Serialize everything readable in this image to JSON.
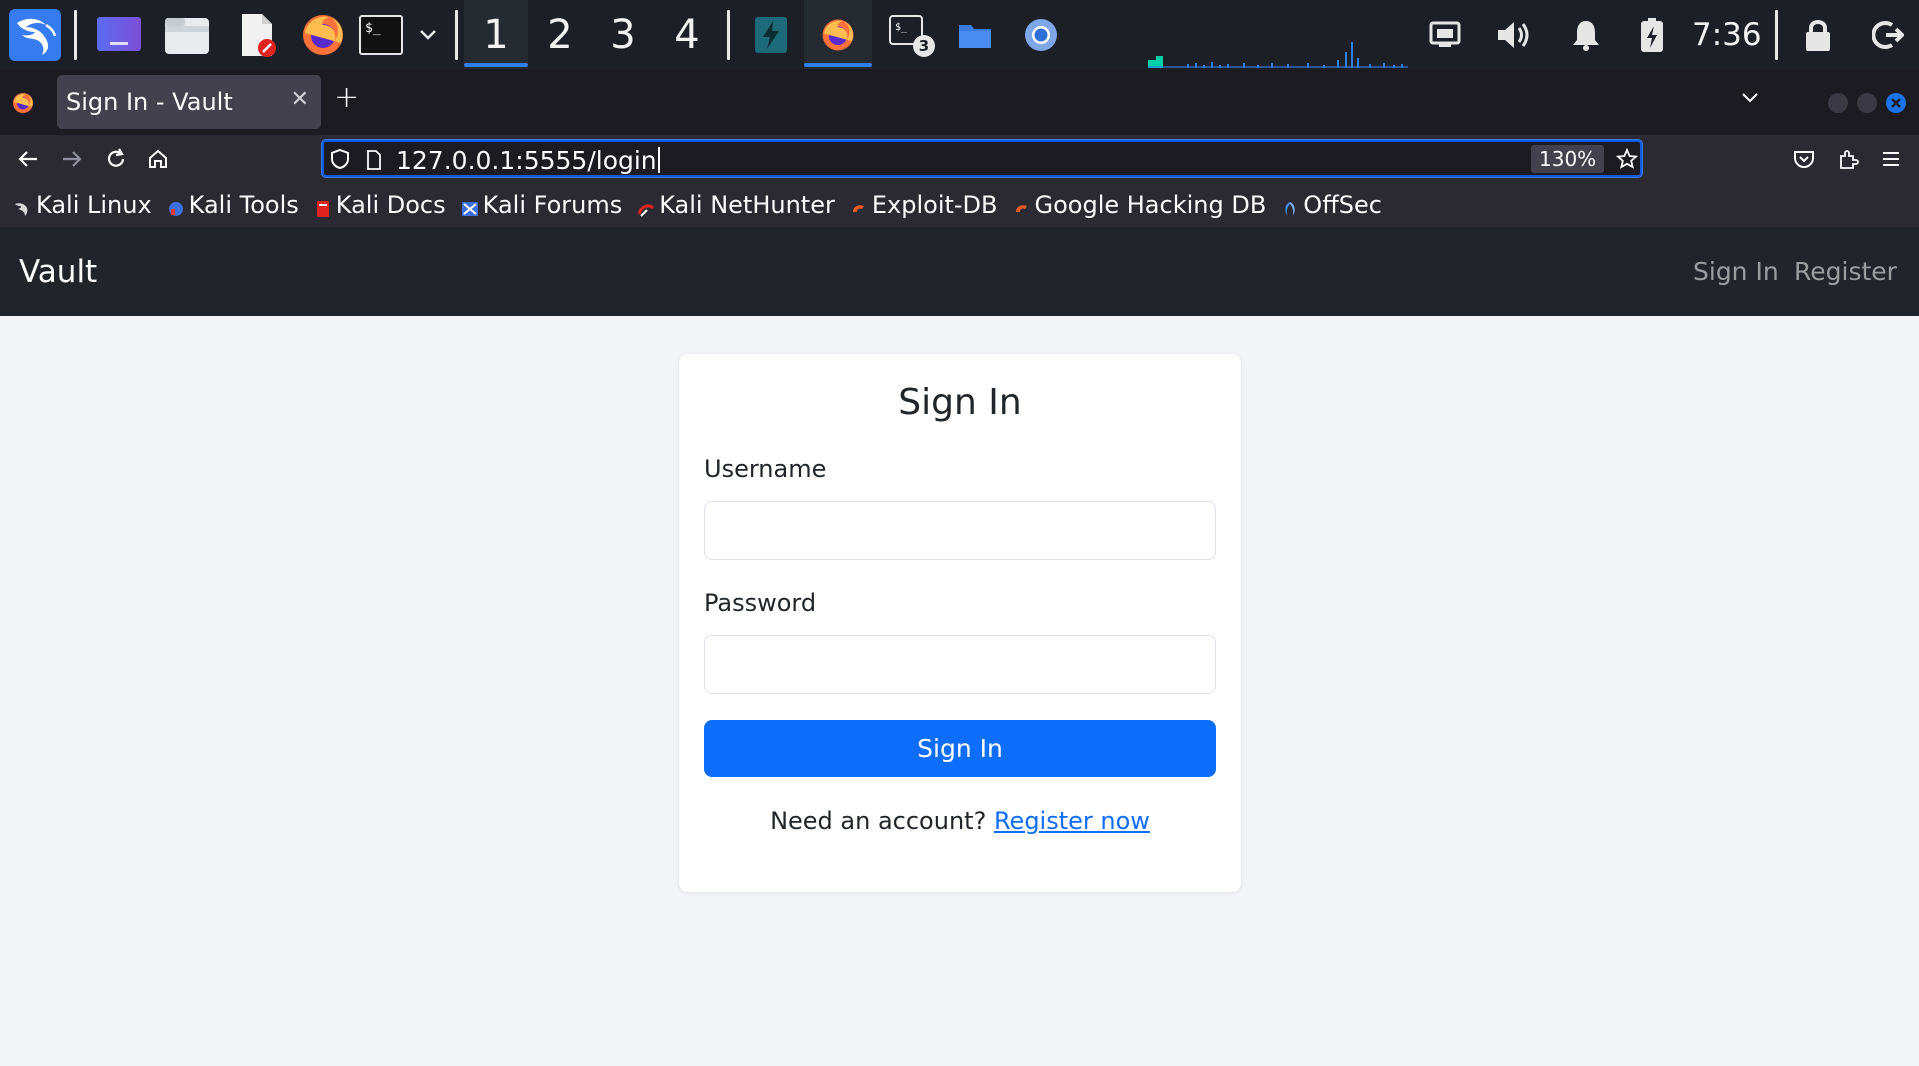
{
  "panel": {
    "workspaces": [
      "1",
      "2",
      "3",
      "4"
    ],
    "active_workspace": "1",
    "terminal_badge": "3",
    "clock": "7:36"
  },
  "browser": {
    "tab_title": "Sign In - Vault",
    "url": "127.0.0.1:5555/login",
    "zoom": "130%",
    "bookmarks": [
      "Kali Linux",
      "Kali Tools",
      "Kali Docs",
      "Kali Forums",
      "Kali NetHunter",
      "Exploit-DB",
      "Google Hacking DB",
      "OffSec"
    ]
  },
  "site": {
    "brand": "Vault",
    "nav_sign_in": "Sign In",
    "nav_register": "Register"
  },
  "login": {
    "title": "Sign In",
    "username_label": "Username",
    "username_value": "",
    "password_label": "Password",
    "password_value": "",
    "submit_label": "Sign In",
    "register_prompt": "Need an account?",
    "register_link": "Register now"
  },
  "colors": {
    "accent": "#0d6efd",
    "navbar": "#212529",
    "panel": "#1c1f25",
    "focus_ring": "#0f5ce0"
  }
}
